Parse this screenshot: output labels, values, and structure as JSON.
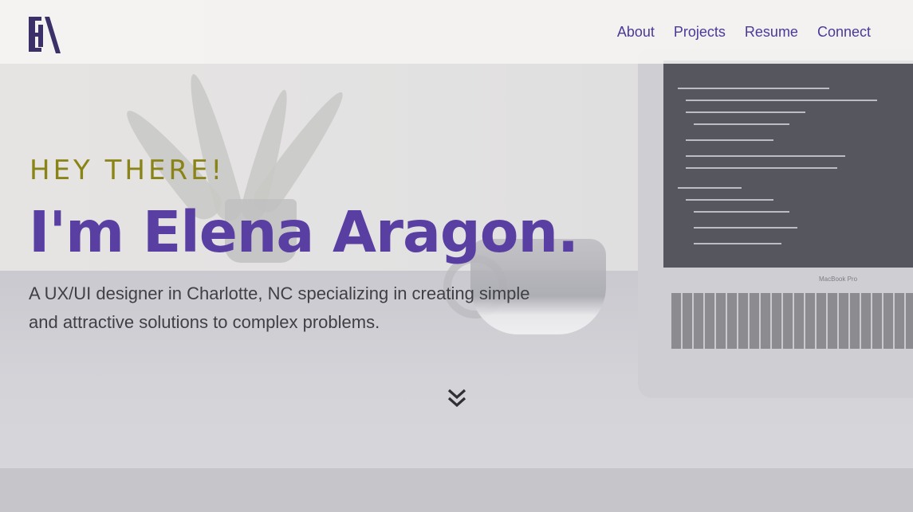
{
  "header": {
    "logo_text": "EA",
    "nav": [
      {
        "label": "About"
      },
      {
        "label": "Projects"
      },
      {
        "label": "Resume"
      },
      {
        "label": "Connect"
      }
    ]
  },
  "hero": {
    "greeting": "HEY THERE!",
    "name": "I'm Elena Aragon.",
    "tagline": "A UX/UI designer in Charlotte, NC specializing in creating simple and attractive solutions to complex problems."
  },
  "background": {
    "laptop_label": "MacBook Pro"
  },
  "colors": {
    "brand_purple": "#5a3fa3",
    "nav_purple": "#4b3a96",
    "accent_olive": "#8a8417",
    "body_text": "#3f3f45"
  },
  "icons": {
    "scroll": "double-chevron-down-icon"
  }
}
